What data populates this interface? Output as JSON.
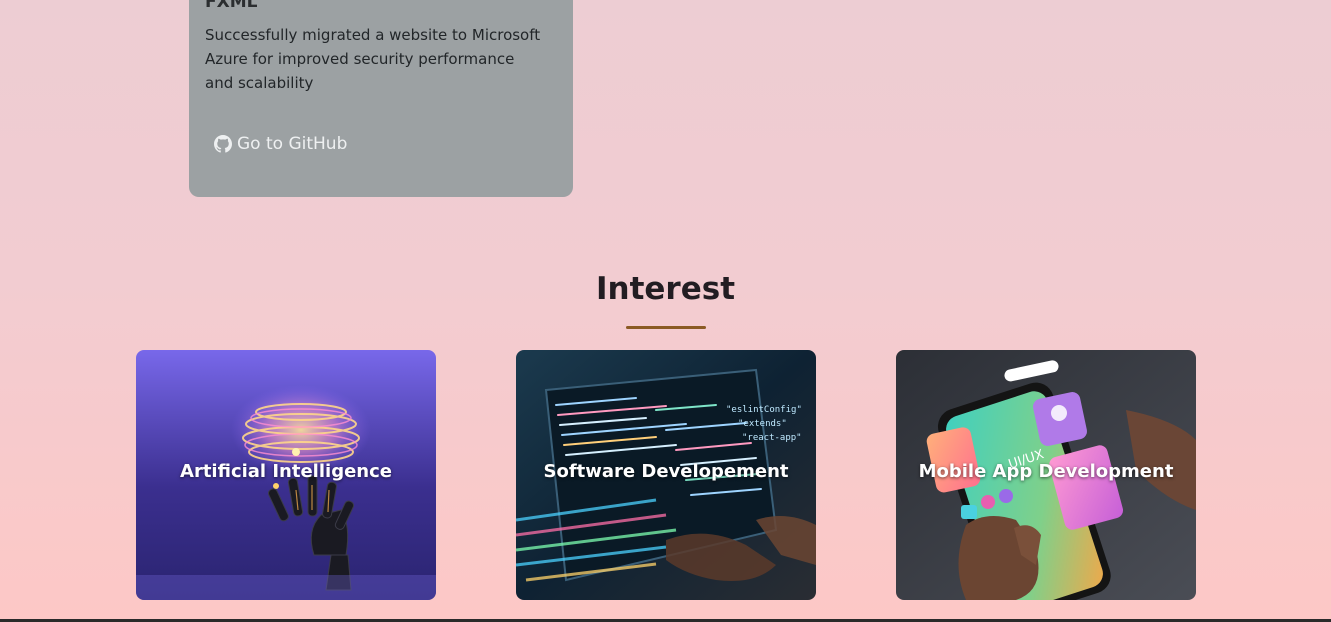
{
  "project": {
    "title": "FXML",
    "description": "Successfully migrated a website to Microsoft Azure for improved security performance and scalability",
    "github_label": "Go to GitHub",
    "github_icon": "github-icon"
  },
  "interest": {
    "title": "Interest",
    "accent_color": "#8b5a24",
    "cards": [
      {
        "label": "Artificial Intelligence",
        "image": "ai-robot-hand-image"
      },
      {
        "label": "Software Developement",
        "image": "code-screen-image"
      },
      {
        "label": "Mobile App Development",
        "image": "phone-ui-ux-image"
      }
    ]
  },
  "colors": {
    "card_bg": "#9ca1a3",
    "page_gradient_top": "#edcdd3",
    "page_gradient_bottom": "#fdc8c6"
  }
}
